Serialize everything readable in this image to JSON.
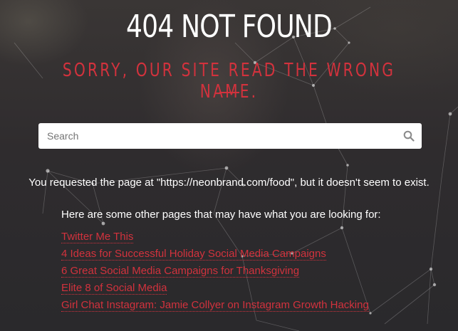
{
  "title": "404 NOT FOUND",
  "subtitle": "SORRY, OUR SITE READ THE WRONG NAME.",
  "search": {
    "placeholder": "Search",
    "value": ""
  },
  "requested_message": "You requested the page at \"https://neonbrand.com/food\", but it doesn't seem to exist.",
  "suggestions_heading": "Here are some other pages that may have what you are looking for:",
  "links": [
    {
      "label": "Twitter Me This"
    },
    {
      "label": "4 Ideas for Successful Holiday Social Media Campaigns"
    },
    {
      "label": "6 Great Social Media Campaigns for Thanksgiving"
    },
    {
      "label": "Elite 8 of Social Media"
    },
    {
      "label": "Girl Chat Instagram: Jamie Collyer on Instagram Growth Hacking"
    }
  ],
  "colors": {
    "accent": "#d2323d",
    "text": "#ffffff",
    "background": "#2d2b2e"
  },
  "icons": {
    "search": "search-icon"
  }
}
